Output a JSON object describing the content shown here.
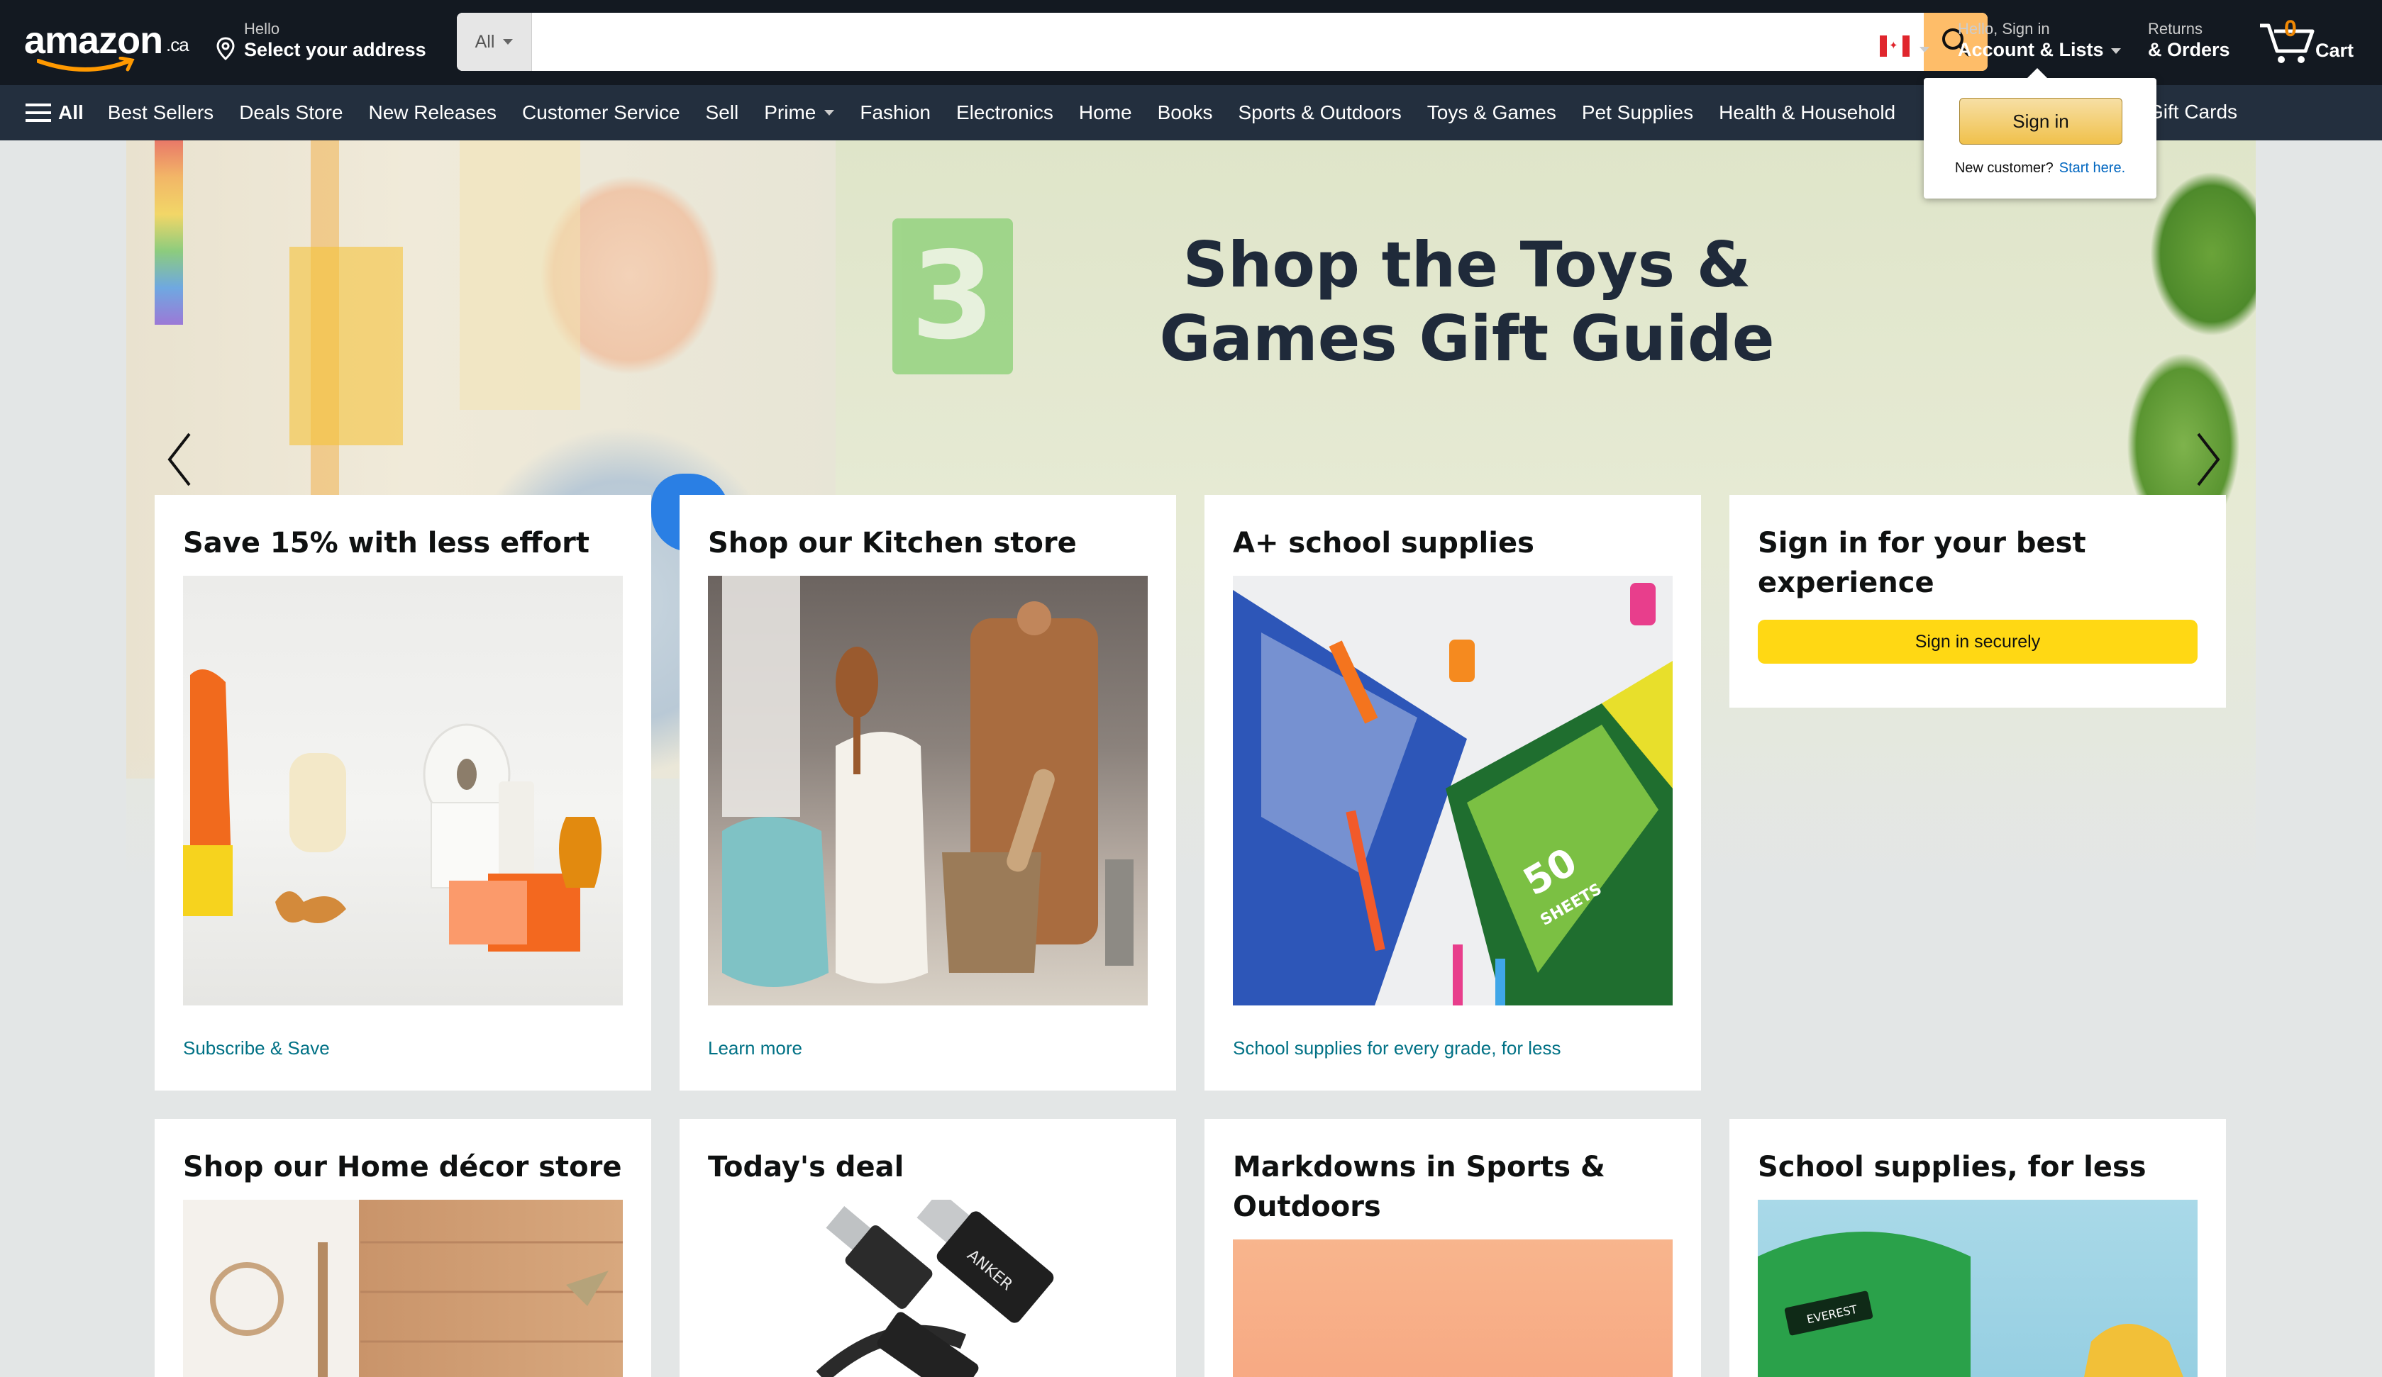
{
  "header": {
    "logo_text": "amazon",
    "logo_tld": ".ca",
    "address_line1": "Hello",
    "address_line2": "Select your address",
    "search_category": "All",
    "search_placeholder": "",
    "country": "Canada",
    "account_line1": "Hello, Sign in",
    "account_line2": "Account & Lists",
    "returns_line1": "Returns",
    "returns_line2": "& Orders",
    "cart_count": "0",
    "cart_label": "Cart"
  },
  "nav": {
    "all_label": "All",
    "items": [
      "Best Sellers",
      "Deals Store",
      "New Releases",
      "Customer Service",
      "Sell",
      "Prime",
      "Fashion",
      "Electronics",
      "Home",
      "Books",
      "Sports & Outdoors",
      "Toys & Games",
      "Pet Supplies",
      "Health & Household"
    ],
    "gift_cards": "Gift Cards"
  },
  "hero": {
    "headline": "Shop the Toys & Games Gift Guide"
  },
  "flyout": {
    "signin_label": "Sign in",
    "new_customer": "New customer?",
    "start_here": "Start here."
  },
  "cards": [
    {
      "title": "Save 15% with less effort",
      "link": "Subscribe & Save"
    },
    {
      "title": "Shop our Kitchen store",
      "link": "Learn more"
    },
    {
      "title": "A+ school supplies",
      "link": "School supplies for every grade, for less"
    },
    {
      "title": "Sign in for your best experience",
      "button": "Sign in securely"
    },
    {
      "title": "Shop our Home décor store"
    },
    {
      "title": "Today's deal"
    },
    {
      "title": "Markdowns in Sports & Outdoors"
    },
    {
      "title": "School supplies, for less"
    }
  ],
  "product_text": {
    "cable_brand": "ANKER",
    "notebook_sheets": "50",
    "notebook_sheets_label": "SHEETS",
    "backpack_brand": "EVEREST"
  },
  "colors": {
    "header_bg": "#131921",
    "nav_bg": "#232f3e",
    "search_button": "#febd69",
    "link": "#007185",
    "signin_button": "#ffd814",
    "cart_count": "#f08804"
  },
  "icons": [
    "map-pin-icon",
    "search-icon",
    "cart-icon",
    "hamburger-icon",
    "chevron-left-icon",
    "chevron-right-icon",
    "caret-down-icon",
    "canada-flag-icon"
  ]
}
